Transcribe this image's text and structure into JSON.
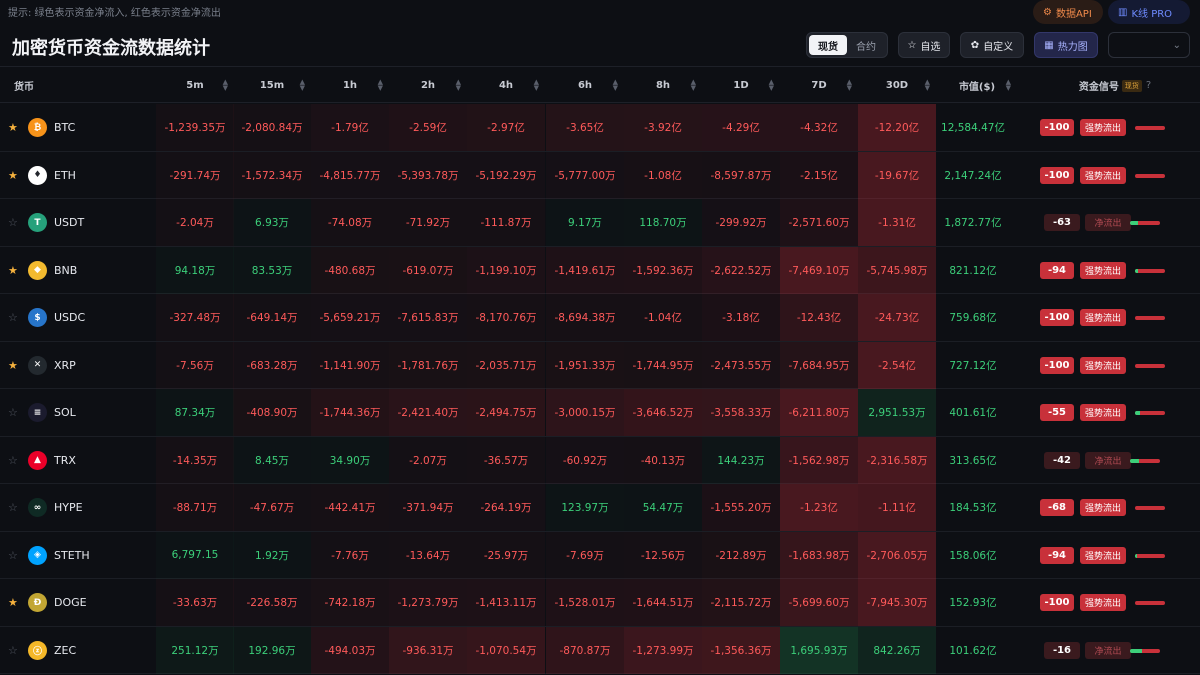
{
  "hint": "提示: 绿色表示资金净流入, 红色表示资金净流出",
  "title": "加密货币资金流数据统计",
  "top_buttons": {
    "api": "数据API",
    "kline": "K线 PRO"
  },
  "market_tabs": [
    "现货",
    "合约"
  ],
  "market_active": "现货",
  "toolbar": {
    "favorites": "自选",
    "custom": "自定义",
    "heatmap": "热力图",
    "select_value": ""
  },
  "columns": {
    "coin": "货币",
    "periods": [
      "5m",
      "15m",
      "1h",
      "2h",
      "4h",
      "6h",
      "8h",
      "1D",
      "7D",
      "30D"
    ],
    "market_cap": "市值($)",
    "signal": "资金信号",
    "signal_tag": "现货",
    "signal_help": "?"
  },
  "colors": {
    "inflow": "#3ccf7a",
    "outflow": "#ff5a5a",
    "strong_outflow_badge": "#c8313a",
    "favorite_star": "#f5b13d"
  },
  "rows": [
    {
      "favorite": true,
      "symbol": "BTC",
      "icon": "bitcoin-icon",
      "icon_color": "#f7931a",
      "glyph": "₿",
      "values": [
        "-1,239.35万",
        "-2,080.84万",
        "-1.79亿",
        "-2.59亿",
        "-2.97亿",
        "-3.65亿",
        "-3.92亿",
        "-4.29亿",
        "-4.32亿",
        "-12.20亿"
      ],
      "market_cap": "12,584.47亿",
      "signal_score": "-100",
      "signal_label": "强势流出",
      "signal_strong": true,
      "inflow_ratio": 0.0
    },
    {
      "favorite": true,
      "symbol": "ETH",
      "icon": "ethereum-icon",
      "icon_color": "#ffffff",
      "glyph": "♦",
      "values": [
        "-291.74万",
        "-1,572.34万",
        "-4,815.77万",
        "-5,393.78万",
        "-5,192.29万",
        "-5,777.00万",
        "-1.08亿",
        "-8,597.87万",
        "-2.15亿",
        "-19.67亿"
      ],
      "market_cap": "2,147.24亿",
      "signal_score": "-100",
      "signal_label": "强势流出",
      "signal_strong": true,
      "inflow_ratio": 0.0
    },
    {
      "favorite": false,
      "symbol": "USDT",
      "icon": "tether-icon",
      "icon_color": "#26a17b",
      "glyph": "T",
      "values": [
        "-2.04万",
        "6.93万",
        "-74.08万",
        "-71.92万",
        "-111.87万",
        "9.17万",
        "118.70万",
        "-299.92万",
        "-2,571.60万",
        "-1.31亿"
      ],
      "market_cap": "1,872.77亿",
      "signal_score": "-63",
      "signal_label": "净流出",
      "signal_strong": false,
      "inflow_ratio": 0.25
    },
    {
      "favorite": true,
      "symbol": "BNB",
      "icon": "bnb-icon",
      "icon_color": "#f3ba2f",
      "glyph": "◆",
      "values": [
        "94.18万",
        "83.53万",
        "-480.68万",
        "-619.07万",
        "-1,199.10万",
        "-1,419.61万",
        "-1,592.36万",
        "-2,622.52万",
        "-7,469.10万",
        "-5,745.98万"
      ],
      "market_cap": "821.12亿",
      "signal_score": "-94",
      "signal_label": "强势流出",
      "signal_strong": true,
      "inflow_ratio": 0.1
    },
    {
      "favorite": false,
      "symbol": "USDC",
      "icon": "usdc-icon",
      "icon_color": "#2775ca",
      "glyph": "$",
      "values": [
        "-327.48万",
        "-649.14万",
        "-5,659.21万",
        "-7,615.83万",
        "-8,170.76万",
        "-8,694.38万",
        "-1.04亿",
        "-3.18亿",
        "-12.43亿",
        "-24.73亿"
      ],
      "market_cap": "759.68亿",
      "signal_score": "-100",
      "signal_label": "强势流出",
      "signal_strong": true,
      "inflow_ratio": 0.0
    },
    {
      "favorite": true,
      "symbol": "XRP",
      "icon": "xrp-icon",
      "icon_color": "#23292f",
      "glyph": "✕",
      "values": [
        "-7.56万",
        "-683.28万",
        "-1,141.90万",
        "-1,781.76万",
        "-2,035.71万",
        "-1,951.33万",
        "-1,744.95万",
        "-2,473.55万",
        "-7,684.95万",
        "-2.54亿"
      ],
      "market_cap": "727.12亿",
      "signal_score": "-100",
      "signal_label": "强势流出",
      "signal_strong": true,
      "inflow_ratio": 0.0
    },
    {
      "favorite": false,
      "symbol": "SOL",
      "icon": "solana-icon",
      "icon_color": "#1b1b2e",
      "glyph": "≡",
      "values": [
        "87.34万",
        "-408.90万",
        "-1,744.36万",
        "-2,421.40万",
        "-2,494.75万",
        "-3,000.15万",
        "-3,646.52万",
        "-3,558.33万",
        "-6,211.80万",
        "2,951.53万"
      ],
      "market_cap": "401.61亿",
      "signal_score": "-55",
      "signal_label": "强势流出",
      "signal_strong": true,
      "inflow_ratio": 0.15
    },
    {
      "favorite": false,
      "symbol": "TRX",
      "icon": "tron-icon",
      "icon_color": "#eb0029",
      "glyph": "▲",
      "values": [
        "-14.35万",
        "8.45万",
        "34.90万",
        "-2.07万",
        "-36.57万",
        "-60.92万",
        "-40.13万",
        "144.23万",
        "-1,562.98万",
        "-2,316.58万"
      ],
      "market_cap": "313.65亿",
      "signal_score": "-42",
      "signal_label": "净流出",
      "signal_strong": false,
      "inflow_ratio": 0.3
    },
    {
      "favorite": false,
      "symbol": "HYPE",
      "icon": "hyperliquid-icon",
      "icon_color": "#0f2a24",
      "glyph": "∞",
      "values": [
        "-88.71万",
        "-47.67万",
        "-442.41万",
        "-371.94万",
        "-264.19万",
        "123.97万",
        "54.47万",
        "-1,555.20万",
        "-1.23亿",
        "-1.11亿"
      ],
      "market_cap": "184.53亿",
      "signal_score": "-68",
      "signal_label": "强势流出",
      "signal_strong": true,
      "inflow_ratio": 0.0
    },
    {
      "favorite": false,
      "symbol": "STETH",
      "icon": "steth-icon",
      "icon_color": "#00a3ff",
      "glyph": "◈",
      "values": [
        "6,797.15",
        "1.92万",
        "-7.76万",
        "-13.64万",
        "-25.97万",
        "-7.69万",
        "-12.56万",
        "-212.89万",
        "-1,683.98万",
        "-2,706.05万"
      ],
      "market_cap": "158.06亿",
      "signal_score": "-94",
      "signal_label": "强势流出",
      "signal_strong": true,
      "inflow_ratio": 0.08
    },
    {
      "favorite": true,
      "symbol": "DOGE",
      "icon": "dogecoin-icon",
      "icon_color": "#c2a633",
      "glyph": "Ð",
      "values": [
        "-33.63万",
        "-226.58万",
        "-742.18万",
        "-1,273.79万",
        "-1,413.11万",
        "-1,528.01万",
        "-1,644.51万",
        "-2,115.72万",
        "-5,699.60万",
        "-7,945.30万"
      ],
      "market_cap": "152.93亿",
      "signal_score": "-100",
      "signal_label": "强势流出",
      "signal_strong": true,
      "inflow_ratio": 0.0
    },
    {
      "favorite": false,
      "symbol": "ZEC",
      "icon": "zcash-icon",
      "icon_color": "#f4b728",
      "glyph": "ⓩ",
      "values": [
        "251.12万",
        "192.96万",
        "-494.03万",
        "-936.31万",
        "-1,070.54万",
        "-870.87万",
        "-1,273.99万",
        "-1,356.36万",
        "1,695.93万",
        "842.26万"
      ],
      "market_cap": "101.62亿",
      "signal_score": "-16",
      "signal_label": "净流出",
      "signal_strong": false,
      "inflow_ratio": 0.4
    }
  ]
}
